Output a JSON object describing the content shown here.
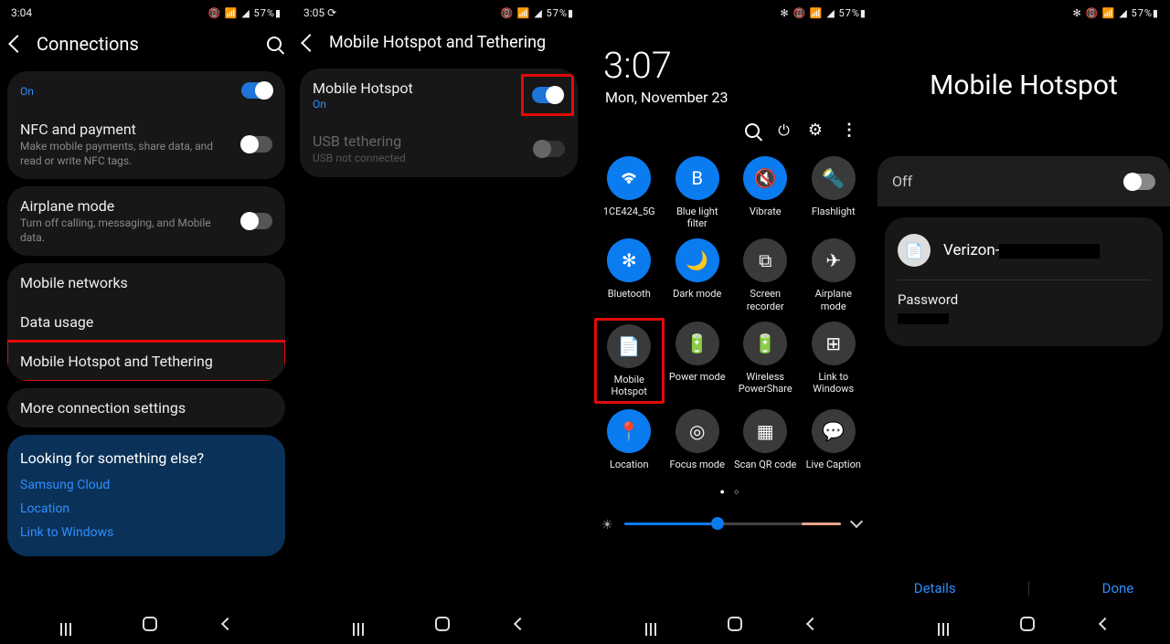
{
  "panel1": {
    "time": "3:04",
    "status_icons": "📵 📶 ◢ 57%▮",
    "title": "Connections",
    "on_label": "On",
    "rows": {
      "nfc": {
        "label": "NFC and payment",
        "sub": "Make mobile payments, share data, and read or write NFC tags."
      },
      "airplane": {
        "label": "Airplane mode",
        "sub": "Turn off calling, messaging, and Mobile data."
      },
      "networks": {
        "label": "Mobile networks"
      },
      "data": {
        "label": "Data usage"
      },
      "hotspot": {
        "label": "Mobile Hotspot and Tethering"
      },
      "more": {
        "label": "More connection settings"
      }
    },
    "help": {
      "q": "Looking for something else?",
      "l1": "Samsung Cloud",
      "l2": "Location",
      "l3": "Link to Windows"
    }
  },
  "panel2": {
    "time": "3:05 ⟳",
    "status_icons": "📵 📶 ◢ 57%▮",
    "title": "Mobile Hotspot and Tethering",
    "hotspot": {
      "label": "Mobile Hotspot",
      "sub": "On"
    },
    "usb": {
      "label": "USB tethering",
      "sub": "USB not connected"
    }
  },
  "panel3": {
    "status_icons": "✻ 📵 📶 ◢ 57%▮",
    "time": "3:07",
    "date": "Mon, November 23",
    "tiles": [
      {
        "label": "1CE424_5G",
        "on": true,
        "glyph": "wifi"
      },
      {
        "label": "Blue light filter",
        "on": true,
        "glyph": "B"
      },
      {
        "label": "Vibrate",
        "on": true,
        "glyph": "🔇"
      },
      {
        "label": "Flashlight",
        "on": false,
        "glyph": "🔦"
      },
      {
        "label": "Bluetooth",
        "on": true,
        "glyph": "✻"
      },
      {
        "label": "Dark mode",
        "on": true,
        "glyph": "🌙"
      },
      {
        "label": "Screen recorder",
        "on": false,
        "glyph": "⧉"
      },
      {
        "label": "Airplane mode",
        "on": false,
        "glyph": "✈"
      },
      {
        "label": "Mobile Hotspot",
        "on": false,
        "glyph": "📄",
        "hl": true
      },
      {
        "label": "Power mode",
        "on": false,
        "glyph": "🔋"
      },
      {
        "label": "Wireless PowerShare",
        "on": false,
        "glyph": "🔋"
      },
      {
        "label": "Link to Windows",
        "on": false,
        "glyph": "⊞"
      },
      {
        "label": "Location",
        "on": true,
        "glyph": "📍"
      },
      {
        "label": "Focus mode",
        "on": false,
        "glyph": "◎"
      },
      {
        "label": "Scan QR code",
        "on": false,
        "glyph": "▦"
      },
      {
        "label": "Live Caption",
        "on": false,
        "glyph": "💬"
      }
    ]
  },
  "panel4": {
    "status_icons": "✻ 📵 📶 ◢ 57%▮",
    "title": "Mobile Hotspot",
    "state": "Off",
    "network": "Verizon-",
    "pwd_label": "Password",
    "details": "Details",
    "done": "Done"
  }
}
